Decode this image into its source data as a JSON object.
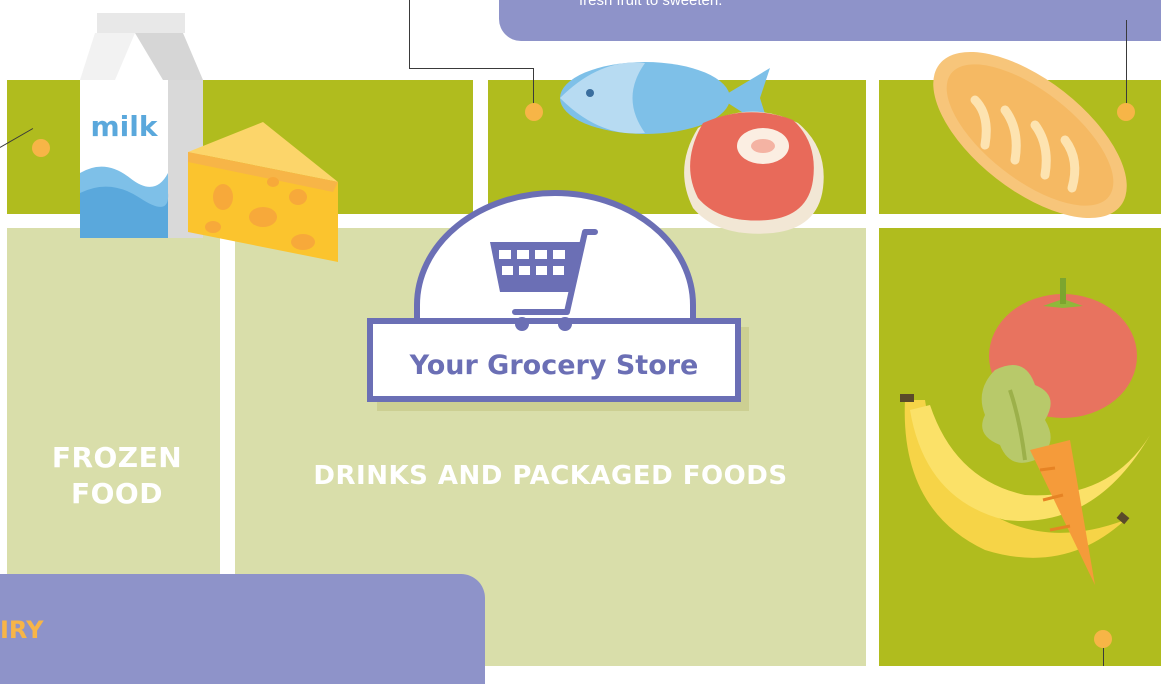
{
  "store": {
    "name": "Your Grocery Store"
  },
  "sections": {
    "frozen": "FROZEN\nFOOD",
    "drinks": "DRINKS AND PACKAGED FOODS"
  },
  "callouts": {
    "top_text": "fresh fruit to sweeten.",
    "bottom_heading": "IRY"
  },
  "carton": {
    "label": "milk"
  },
  "colors": {
    "aisle_green": "#b0bc1e",
    "aisle_pale": "#d9deaa",
    "callout_purple": "#8e93c9",
    "marker_orange": "#f7b547",
    "sign_blue": "#6b6fb5"
  },
  "icons": [
    "milk-carton-icon",
    "cheese-icon",
    "fish-icon",
    "steak-icon",
    "bread-icon",
    "shopping-cart-icon",
    "tomato-icon",
    "lettuce-icon",
    "banana-icon",
    "carrot-icon"
  ]
}
